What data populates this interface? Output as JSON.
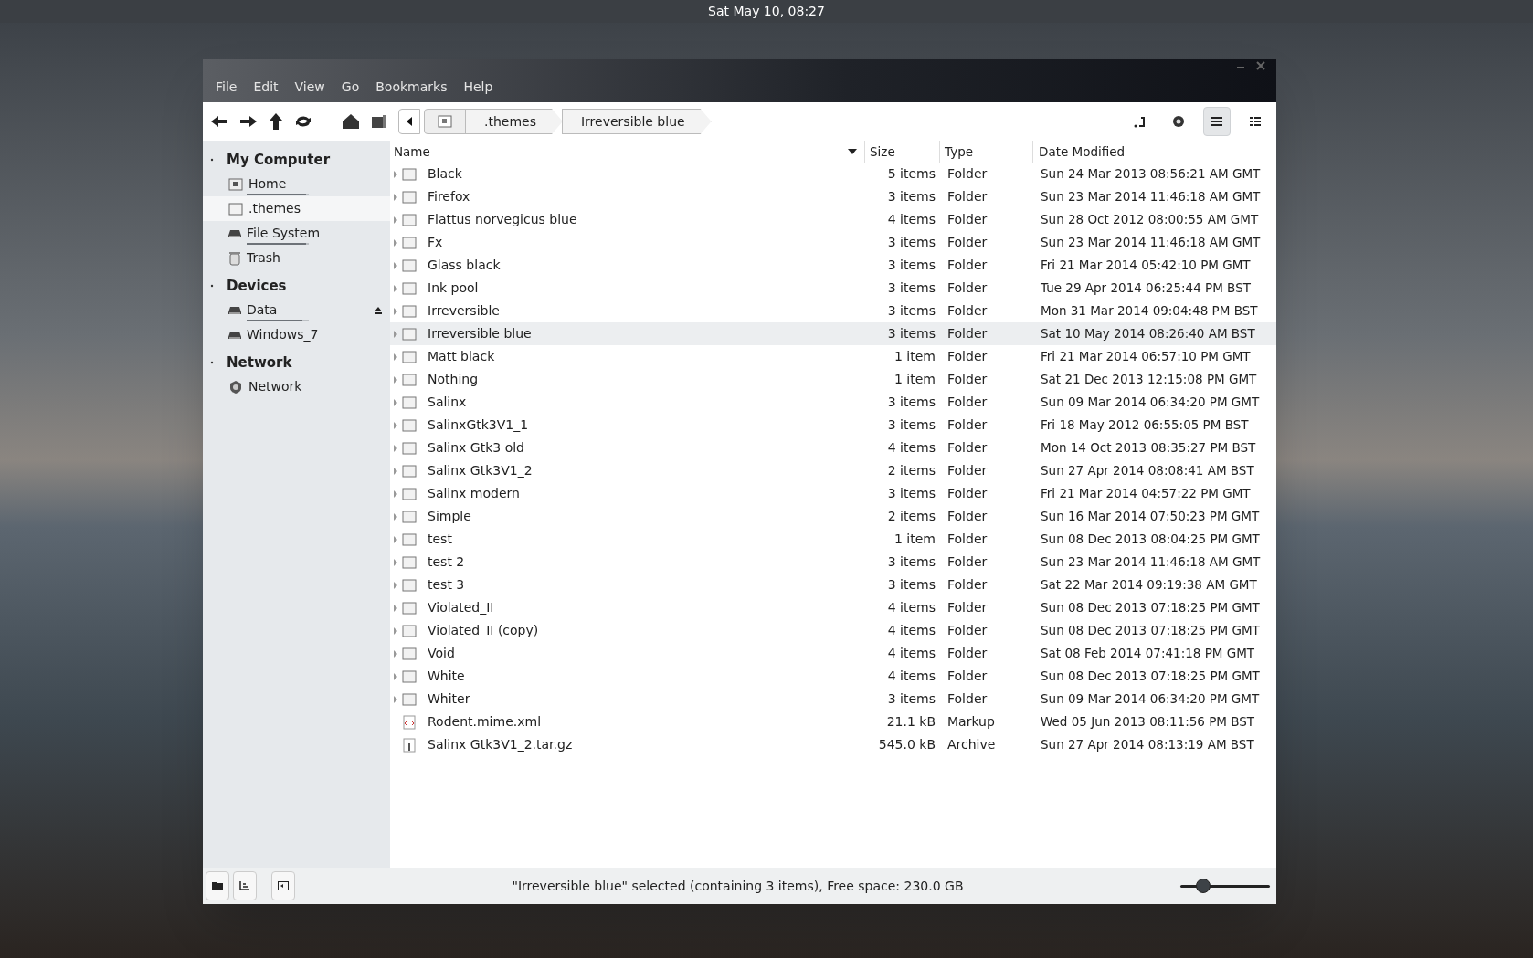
{
  "top_bar": {
    "clock": "Sat May 10, 08:27"
  },
  "menu": [
    "File",
    "Edit",
    "View",
    "Go",
    "Bookmarks",
    "Help"
  ],
  "breadcrumb": [
    ".themes",
    "Irreversible blue"
  ],
  "view_buttons": [
    {
      "kind": "compact",
      "selected": false
    },
    {
      "kind": "icons",
      "selected": false
    },
    {
      "kind": "list",
      "selected": true
    },
    {
      "kind": "columns",
      "selected": false
    }
  ],
  "sidebar": [
    {
      "title": "My Computer",
      "items": [
        {
          "label": "Home",
          "kind": "home",
          "selected": false,
          "level": 0.95
        },
        {
          "label": ".themes",
          "kind": "folder",
          "selected": true
        },
        {
          "label": "File System",
          "kind": "drive",
          "selected": false,
          "level": 0.95
        },
        {
          "label": "Trash",
          "kind": "trash",
          "selected": false
        }
      ]
    },
    {
      "title": "Devices",
      "items": [
        {
          "label": "Data",
          "kind": "drive",
          "selected": false,
          "level": 0.9,
          "eject": true
        },
        {
          "label": "Windows_7",
          "kind": "drive",
          "selected": false
        }
      ]
    },
    {
      "title": "Network",
      "items": [
        {
          "label": "Network",
          "kind": "network",
          "selected": false
        }
      ]
    }
  ],
  "table": {
    "columns": [
      "Name",
      "Size",
      "Type",
      "Date Modified"
    ],
    "rows": [
      {
        "name": "Black",
        "size": "5 items",
        "type": "Folder",
        "date": "Sun 24 Mar 2013 08:56:21 AM GMT",
        "kind": "folder",
        "selected": false
      },
      {
        "name": "Firefox",
        "size": "3 items",
        "type": "Folder",
        "date": "Sun 23 Mar 2014 11:46:18 AM GMT",
        "kind": "folder",
        "selected": false
      },
      {
        "name": "Flattus norvegicus blue",
        "size": "4 items",
        "type": "Folder",
        "date": "Sun 28 Oct 2012 08:00:55 AM GMT",
        "kind": "folder",
        "selected": false
      },
      {
        "name": "Fx",
        "size": "3 items",
        "type": "Folder",
        "date": "Sun 23 Mar 2014 11:46:18 AM GMT",
        "kind": "folder",
        "selected": false
      },
      {
        "name": "Glass black",
        "size": "3 items",
        "type": "Folder",
        "date": "Fri 21 Mar 2014 05:42:10 PM GMT",
        "kind": "folder",
        "selected": false
      },
      {
        "name": "Ink pool",
        "size": "3 items",
        "type": "Folder",
        "date": "Tue 29 Apr 2014 06:25:44 PM BST",
        "kind": "folder",
        "selected": false
      },
      {
        "name": "Irreversible",
        "size": "3 items",
        "type": "Folder",
        "date": "Mon 31 Mar 2014 09:04:48 PM BST",
        "kind": "folder",
        "selected": false
      },
      {
        "name": "Irreversible blue",
        "size": "3 items",
        "type": "Folder",
        "date": "Sat 10 May 2014 08:26:40 AM BST",
        "kind": "folder",
        "selected": true
      },
      {
        "name": "Matt black",
        "size": "1 item",
        "type": "Folder",
        "date": "Fri 21 Mar 2014 06:57:10 PM GMT",
        "kind": "folder",
        "selected": false
      },
      {
        "name": "Nothing",
        "size": "1 item",
        "type": "Folder",
        "date": "Sat 21 Dec 2013 12:15:08 PM GMT",
        "kind": "folder",
        "selected": false
      },
      {
        "name": "Salinx",
        "size": "3 items",
        "type": "Folder",
        "date": "Sun 09 Mar 2014 06:34:20 PM GMT",
        "kind": "folder",
        "selected": false
      },
      {
        "name": "SalinxGtk3V1_1",
        "size": "3 items",
        "type": "Folder",
        "date": "Fri 18 May 2012 06:55:05 PM BST",
        "kind": "folder",
        "selected": false
      },
      {
        "name": "Salinx Gtk3 old",
        "size": "4 items",
        "type": "Folder",
        "date": "Mon 14 Oct 2013 08:35:27 PM BST",
        "kind": "folder",
        "selected": false
      },
      {
        "name": "Salinx Gtk3V1_2",
        "size": "2 items",
        "type": "Folder",
        "date": "Sun 27 Apr 2014 08:08:41 AM BST",
        "kind": "folder",
        "selected": false
      },
      {
        "name": "Salinx modern",
        "size": "3 items",
        "type": "Folder",
        "date": "Fri 21 Mar 2014 04:57:22 PM GMT",
        "kind": "folder",
        "selected": false
      },
      {
        "name": "Simple",
        "size": "2 items",
        "type": "Folder",
        "date": "Sun 16 Mar 2014 07:50:23 PM GMT",
        "kind": "folder",
        "selected": false
      },
      {
        "name": "test",
        "size": "1 item",
        "type": "Folder",
        "date": "Sun 08 Dec 2013 08:04:25 PM GMT",
        "kind": "folder",
        "selected": false
      },
      {
        "name": "test 2",
        "size": "3 items",
        "type": "Folder",
        "date": "Sun 23 Mar 2014 11:46:18 AM GMT",
        "kind": "folder",
        "selected": false
      },
      {
        "name": "test 3",
        "size": "3 items",
        "type": "Folder",
        "date": "Sat 22 Mar 2014 09:19:38 AM GMT",
        "kind": "folder",
        "selected": false
      },
      {
        "name": "Violated_II",
        "size": "4 items",
        "type": "Folder",
        "date": "Sun 08 Dec 2013 07:18:25 PM GMT",
        "kind": "folder",
        "selected": false
      },
      {
        "name": "Violated_II (copy)",
        "size": "4 items",
        "type": "Folder",
        "date": "Sun 08 Dec 2013 07:18:25 PM GMT",
        "kind": "folder",
        "selected": false
      },
      {
        "name": "Void",
        "size": "4 items",
        "type": "Folder",
        "date": "Sat 08 Feb 2014 07:41:18 PM GMT",
        "kind": "folder",
        "selected": false
      },
      {
        "name": "White",
        "size": "4 items",
        "type": "Folder",
        "date": "Sun 08 Dec 2013 07:18:25 PM GMT",
        "kind": "folder",
        "selected": false
      },
      {
        "name": "Whiter",
        "size": "3 items",
        "type": "Folder",
        "date": "Sun 09 Mar 2014 06:34:20 PM GMT",
        "kind": "folder",
        "selected": false
      },
      {
        "name": "Rodent.mime.xml",
        "size": "21.1 kB",
        "type": "Markup",
        "date": "Wed 05 Jun 2013 08:11:56 PM BST",
        "kind": "markup",
        "selected": false
      },
      {
        "name": "Salinx Gtk3V1_2.tar.gz",
        "size": "545.0 kB",
        "type": "Archive",
        "date": "Sun 27 Apr 2014 08:13:19 AM BST",
        "kind": "archive",
        "selected": false
      }
    ]
  },
  "status_bar": {
    "text": "\"Irreversible blue\" selected (containing 3 items), Free space: 230.0 GB",
    "zoom": {
      "level": 0.25
    }
  }
}
